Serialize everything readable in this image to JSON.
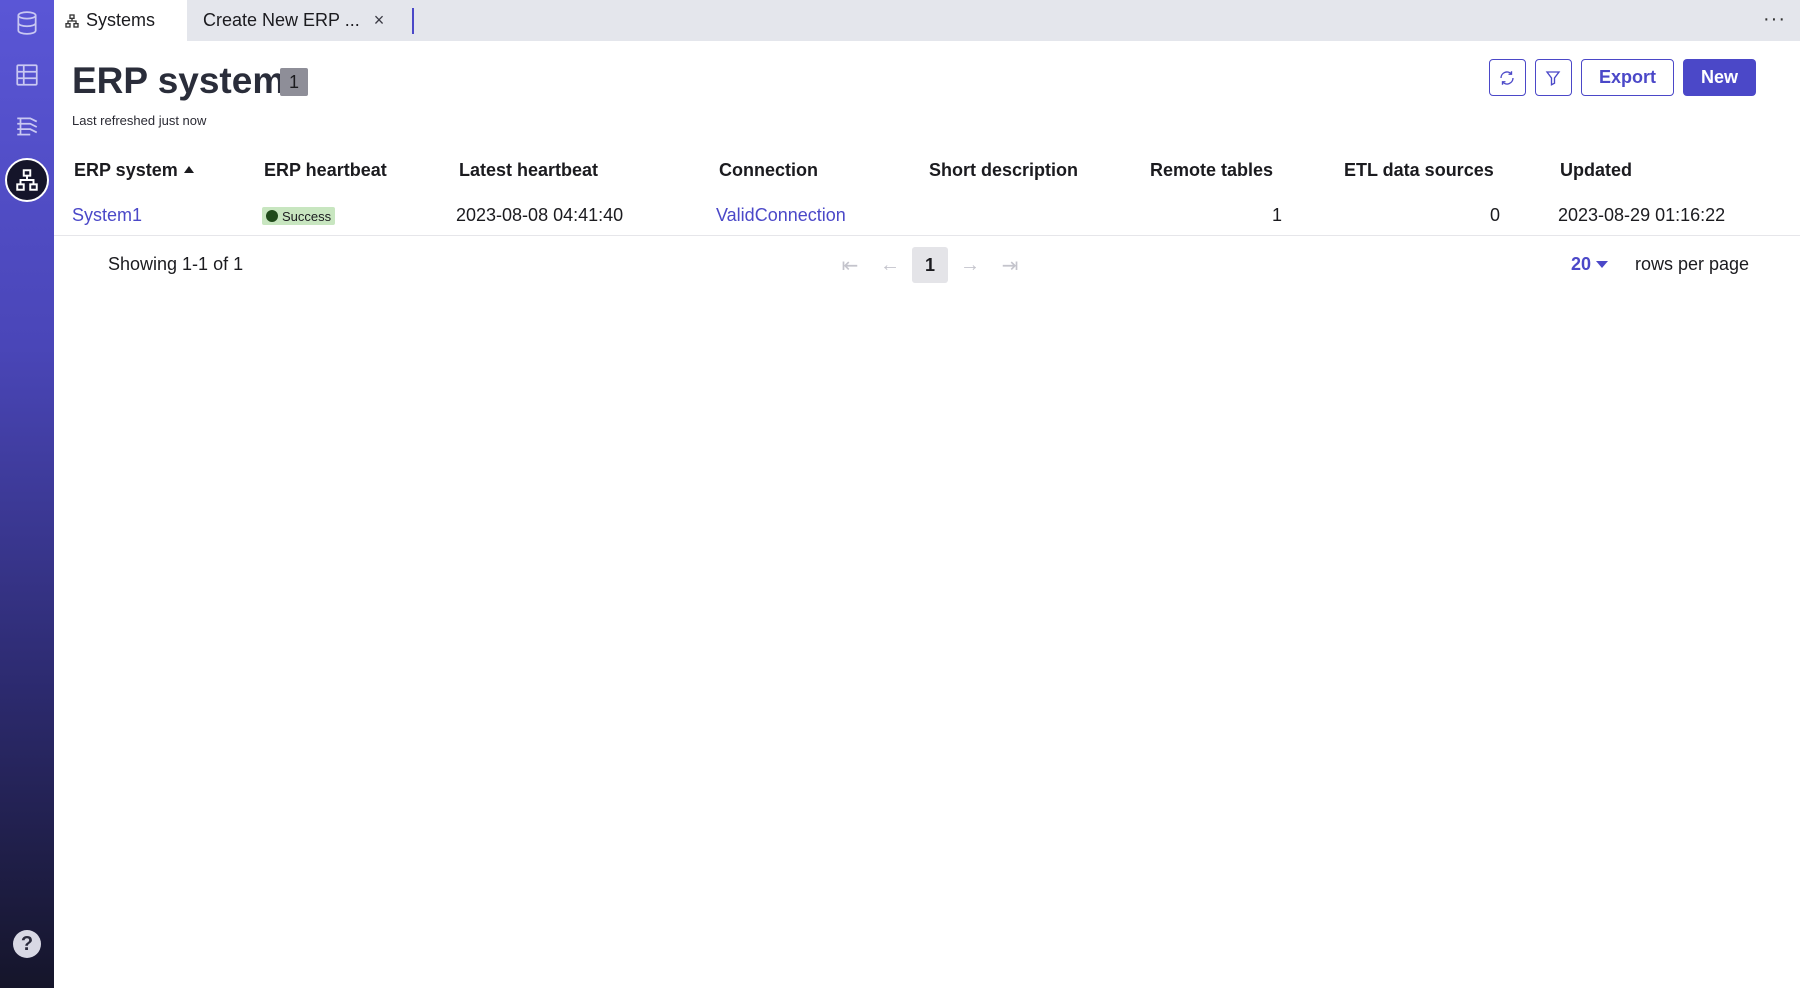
{
  "tabs": {
    "active_label": "Systems",
    "second_label": "Create New ERP ...",
    "close_glyph": "×",
    "more_glyph": "···"
  },
  "sidebar": {
    "items": [
      "database-icon",
      "table-icon",
      "layers-icon",
      "systems-icon"
    ],
    "help_glyph": "?"
  },
  "header": {
    "title": "ERP systems",
    "count": "1",
    "refreshed": "Last refreshed just now",
    "export_label": "Export",
    "new_label": "New"
  },
  "table": {
    "columns": [
      "ERP system",
      "ERP heartbeat",
      "Latest heartbeat",
      "Connection",
      "Short description",
      "Remote tables",
      "ETL data sources",
      "Updated"
    ],
    "rows": [
      {
        "system": "System1",
        "heartbeat": "Success",
        "latest": "2023-08-08 04:41:40",
        "connection": "ValidConnection",
        "description": "",
        "remote_tables": "1",
        "etl_sources": "0",
        "updated": "2023-08-29 01:16:22"
      }
    ]
  },
  "pagination": {
    "showing": "Showing 1-1 of 1",
    "current_page": "1",
    "first_glyph": "⇤",
    "prev_glyph": "←",
    "next_glyph": "→",
    "last_glyph": "⇥",
    "rows_per_page_value": "20",
    "rows_per_page_label": "rows per page"
  },
  "colors": {
    "accent": "#4b48c8",
    "success_bg": "#c8e6c0",
    "success_dot": "#1f4a1a"
  }
}
